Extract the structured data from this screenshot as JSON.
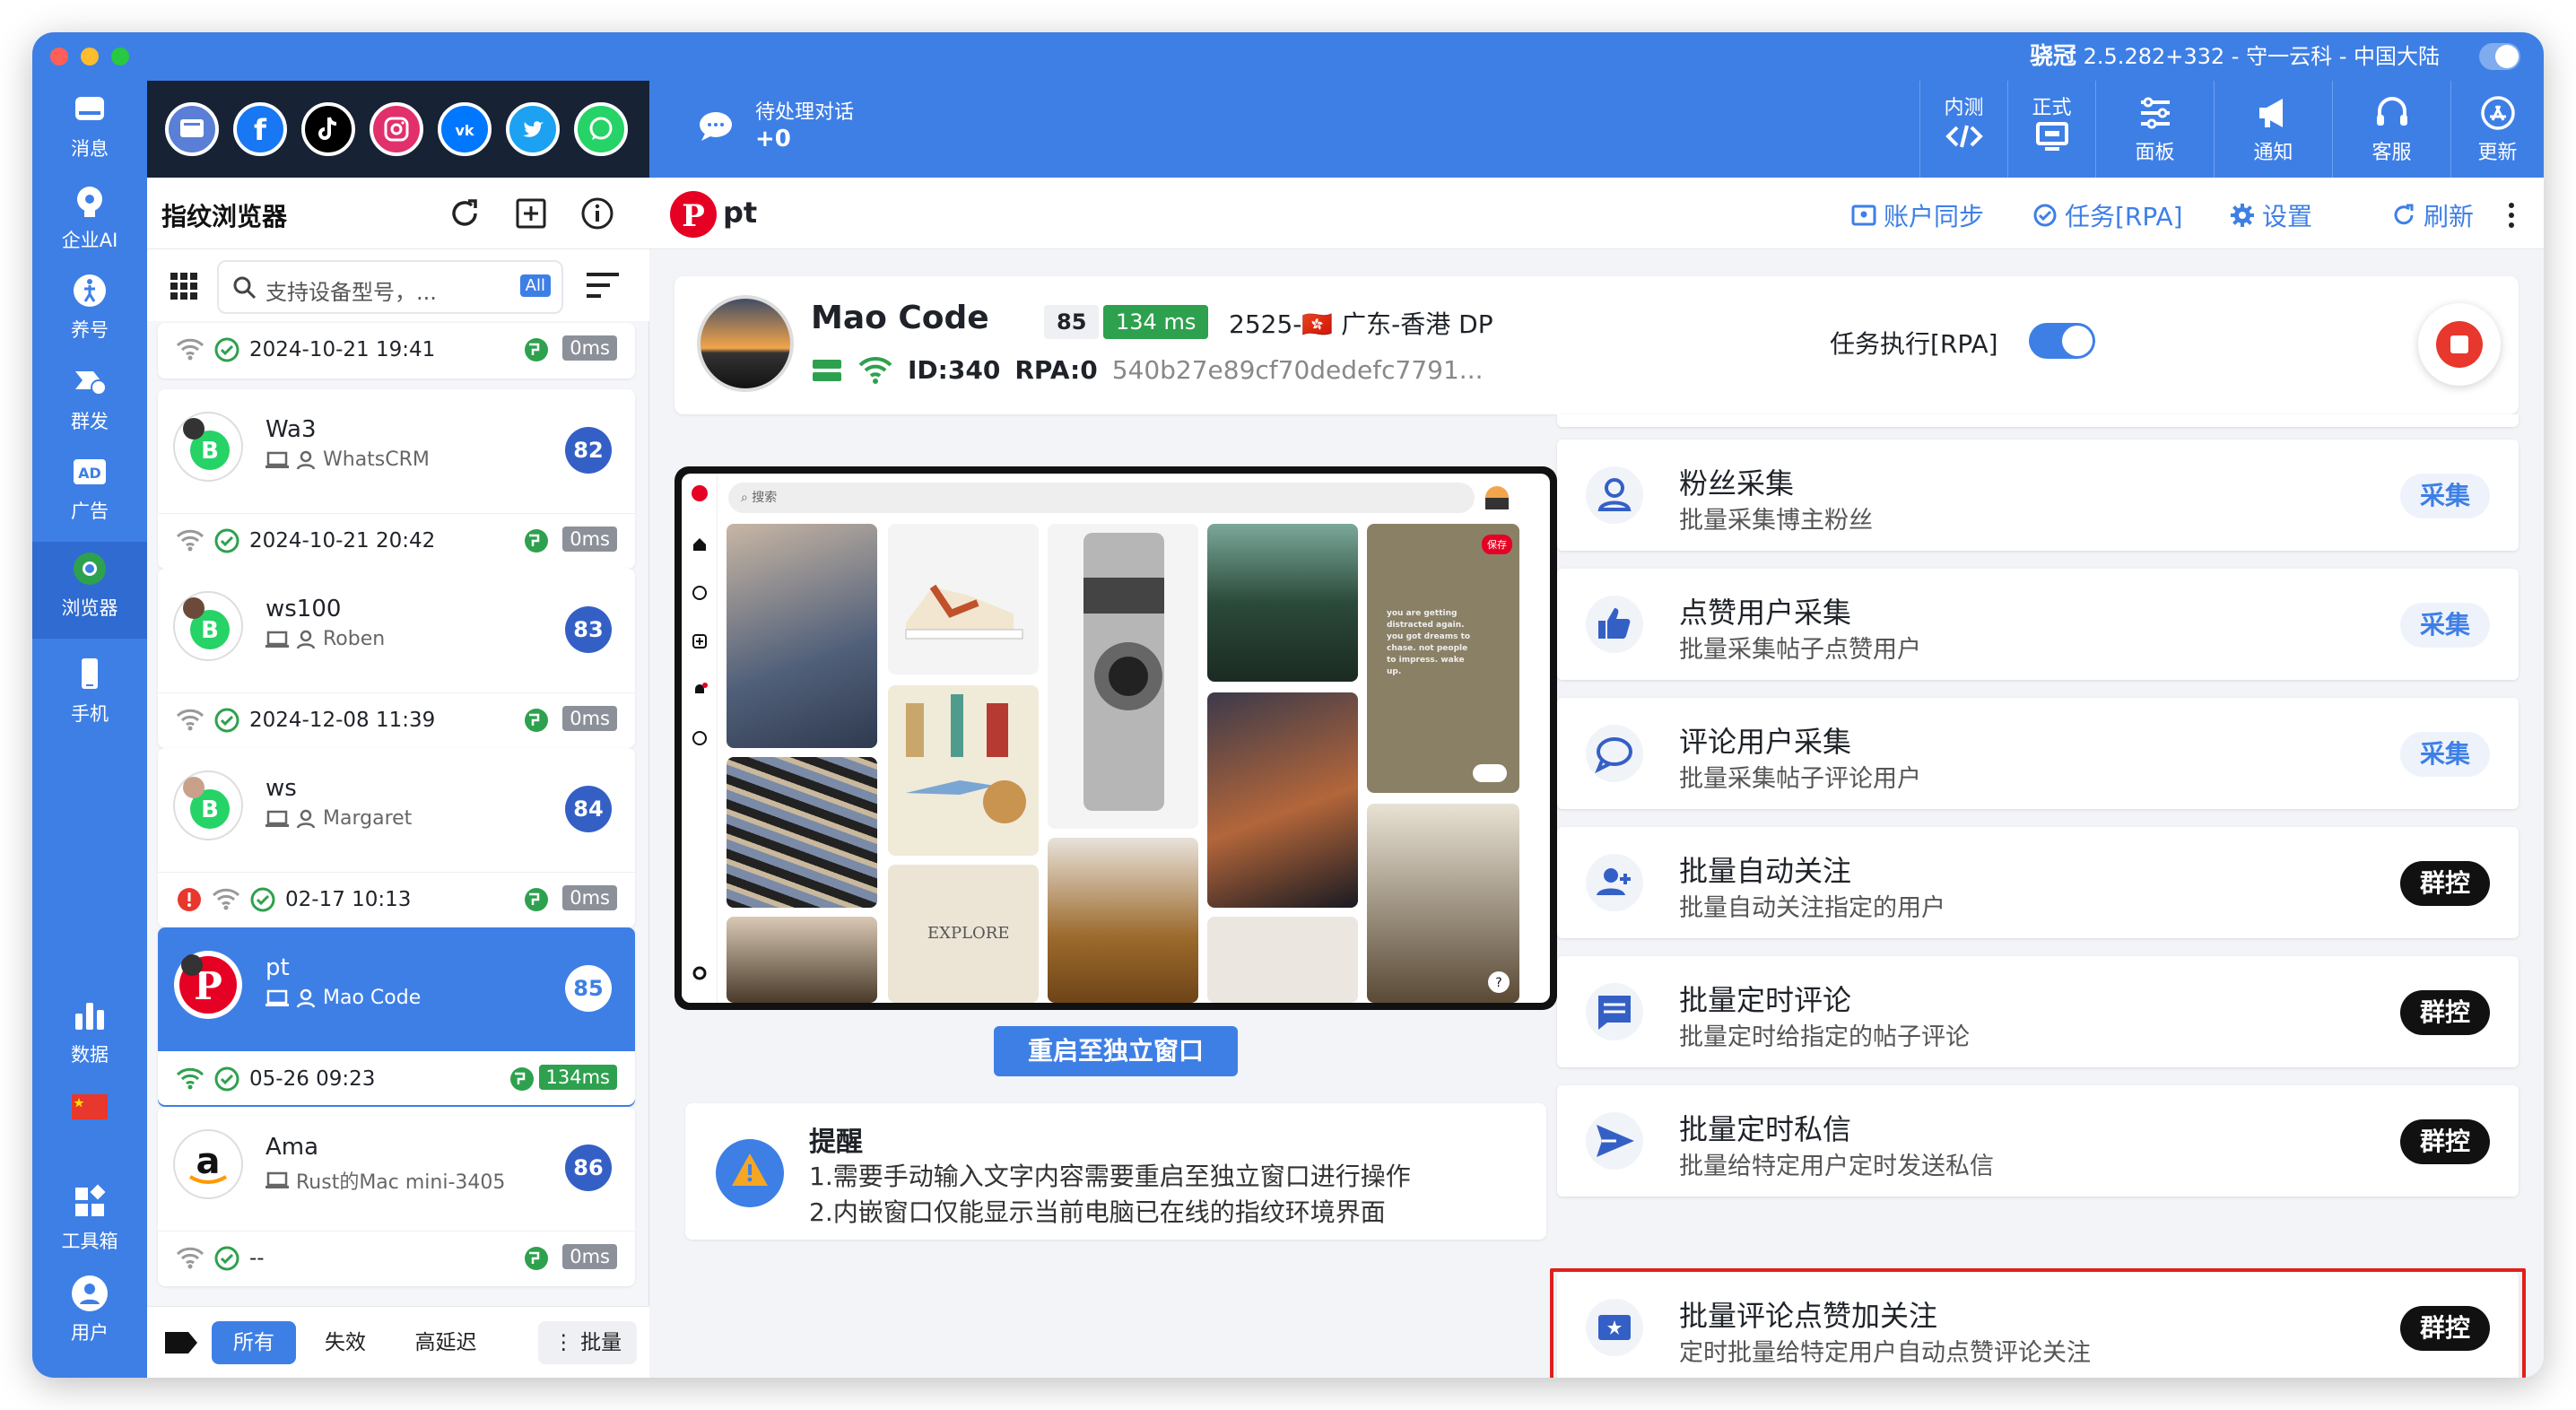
{
  "window": {
    "version_bold": "骁冠",
    "version_text": "2.5.282+332 - 守一云科 - 中国大陆"
  },
  "leftnav": [
    {
      "label": "消息",
      "icon": "inbox-icon"
    },
    {
      "label": "企业AI",
      "icon": "ai-head-icon"
    },
    {
      "label": "养号",
      "icon": "walk-icon"
    },
    {
      "label": "群发",
      "icon": "broadcast-icon"
    },
    {
      "label": "广告",
      "icon": "ad-icon"
    },
    {
      "label": "浏览器",
      "icon": "chrome-icon"
    },
    {
      "label": "手机",
      "icon": "phone-icon"
    },
    {
      "label": "数据",
      "icon": "bar-chart-icon"
    },
    {
      "label": "",
      "icon": "china-flag-icon"
    },
    {
      "label": "工具箱",
      "icon": "toolbox-icon"
    },
    {
      "label": "用户",
      "icon": "user-icon"
    }
  ],
  "toolbar": {
    "pending_label": "待处理对话",
    "pending_count": "+0",
    "buttons": [
      {
        "label": "内测",
        "icon": "code-icon"
      },
      {
        "label": "正式",
        "icon": "monitor-icon"
      },
      {
        "label": "面板",
        "icon": "sliders-icon"
      },
      {
        "label": "通知",
        "icon": "megaphone-icon"
      },
      {
        "label": "客服",
        "icon": "headset-icon"
      },
      {
        "label": "更新",
        "icon": "appstore-icon"
      }
    ]
  },
  "social_icons": [
    "browser-icon",
    "facebook-icon",
    "tiktok-icon",
    "instagram-icon",
    "vk-icon",
    "twitter-icon",
    "whatsapp-icon"
  ],
  "left_panel": {
    "title": "指纹浏览器",
    "search_placeholder": "支持设备型号，...",
    "search_tag": "All",
    "top_row": {
      "time": "2024-10-21 19:41",
      "ms": "0ms"
    },
    "cards": [
      {
        "name": "Wa3",
        "sub": "WhatsCRM",
        "badge": "82",
        "time": "2024-10-21 20:42",
        "ms": "0ms"
      },
      {
        "name": "ws100",
        "sub": "Roben",
        "badge": "83",
        "time": "2024-12-08 11:39",
        "ms": "0ms"
      },
      {
        "name": "ws",
        "sub": "Margaret",
        "badge": "84",
        "time": "02-17 10:13",
        "ms": "0ms"
      },
      {
        "name": "pt",
        "sub": "Mao Code",
        "badge": "85",
        "time": "05-26 09:23",
        "ms": "134ms"
      },
      {
        "name": "Ama",
        "sub": "Rust的Mac mini-3405",
        "badge": "86",
        "time": "--",
        "ms": "0ms"
      }
    ],
    "footer": {
      "all": "所有",
      "invalid": "失效",
      "high_latency": "高延迟",
      "batch": "批量"
    }
  },
  "main": {
    "header_title": "pt",
    "links": {
      "sync": "账户同步",
      "task": "任务[RPA]",
      "settings": "设置",
      "refresh": "刷新"
    },
    "profile": {
      "name": "Mao Code",
      "score": "85",
      "latency": "134 ms",
      "location": "2525-🇭🇰 广东-香港 DP",
      "id": "ID:340",
      "rpa": "RPA:0",
      "hash": "540b27e89cf70dedefc7791...",
      "task_label": "任务执行[RPA]"
    },
    "browser": {
      "search_text": "搜索",
      "save": "保存",
      "quote": "you are getting distracted again. you got dreams to chase. not people to impress. wake up.",
      "explore": "EXPLORE"
    },
    "restart_button": "重启至独立窗口",
    "notice": {
      "title": "提醒",
      "line1": "1.需要手动输入文字内容需要重启至独立窗口进行操作",
      "line2": "2.内嵌窗口仅能显示当前电脑已在线的指纹环境界面"
    },
    "features": [
      {
        "title": "粉丝采集",
        "desc": "批量采集博主粉丝",
        "button": "采集",
        "style": "blue",
        "icon": "person-icon"
      },
      {
        "title": "点赞用户采集",
        "desc": "批量采集帖子点赞用户",
        "button": "采集",
        "style": "blue",
        "icon": "thumbs-up-icon"
      },
      {
        "title": "评论用户采集",
        "desc": "批量采集帖子评论用户",
        "button": "采集",
        "style": "blue",
        "icon": "comment-icon"
      },
      {
        "title": "批量自动关注",
        "desc": "批量自动关注指定的用户",
        "button": "群控",
        "style": "dark",
        "icon": "person-add-icon"
      },
      {
        "title": "批量定时评论",
        "desc": "批量定时给指定的帖子评论",
        "button": "群控",
        "style": "dark",
        "icon": "message-icon"
      },
      {
        "title": "批量定时私信",
        "desc": "批量给特定用户定时发送私信",
        "button": "群控",
        "style": "dark",
        "icon": "send-icon"
      },
      {
        "title": "批量评论点赞加关注",
        "desc": "定时批量给特定用户自动点赞评论关注",
        "button": "群控",
        "style": "dark",
        "icon": "star-box-icon"
      }
    ]
  }
}
